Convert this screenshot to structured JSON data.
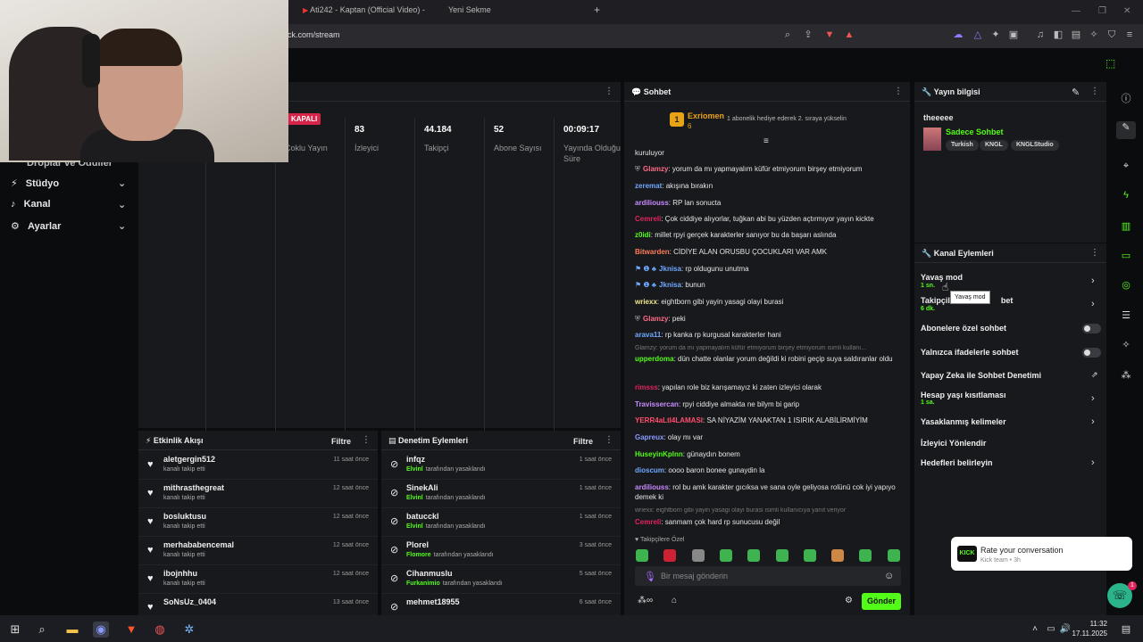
{
  "browser": {
    "tabs": [
      {
        "label": "Ati242 - Kaptan (Official Video) -"
      },
      {
        "label": "Yeni Sekme"
      }
    ],
    "new_tab_label": "+",
    "url": "ck.com/stream"
  },
  "sidebar": {
    "partial_item": "Droplar ve Ödüller",
    "items": [
      {
        "label": "Stüdyo"
      },
      {
        "label": "Kanal"
      },
      {
        "label": "Ayarlar"
      }
    ]
  },
  "stats": {
    "status_badge": "KAPALI",
    "items": [
      {
        "value": "",
        "label": "Çoklu Yayın"
      },
      {
        "value": "83",
        "label": "İzleyici"
      },
      {
        "value": "44.184",
        "label": "Takipçi"
      },
      {
        "value": "52",
        "label": "Abone Sayısı"
      },
      {
        "value": "00:09:17",
        "label": "Yayında Olduğu Süre"
      }
    ]
  },
  "activity": {
    "title": "Etkinlik Akışı",
    "filter_label": "Filtre",
    "events": [
      {
        "name": "aletgergin512",
        "sub": "kanalı takip etti",
        "time": "11 saat önce"
      },
      {
        "name": "mithrasthegreat",
        "sub": "kanalı takip etti",
        "time": "12 saat önce"
      },
      {
        "name": "bosluktusu",
        "sub": "kanalı takip etti",
        "time": "12 saat önce"
      },
      {
        "name": "merhababencemal",
        "sub": "kanalı takip etti",
        "time": "12 saat önce"
      },
      {
        "name": "ibojnhhu",
        "sub": "kanalı takip etti",
        "time": "12 saat önce"
      },
      {
        "name": "SoNsUz_0404",
        "sub": "",
        "time": "13 saat önce"
      }
    ]
  },
  "moderation": {
    "title": "Denetim Eylemleri",
    "filter_label": "Filtre",
    "actions": [
      {
        "name": "infqz",
        "mod": "Elvinl",
        "sub": "tarafından yasaklandı",
        "time": "1 saat önce"
      },
      {
        "name": "SinekAli",
        "mod": "Elvinl",
        "sub": "tarafından yasaklandı",
        "time": "1 saat önce"
      },
      {
        "name": "batucckl",
        "mod": "Elvinl",
        "sub": "tarafından yasaklandı",
        "time": "1 saat önce"
      },
      {
        "name": "Plorel",
        "mod": "Flomore",
        "sub": "tarafından yasaklandı",
        "time": "3 saat önce"
      },
      {
        "name": "Cihanmuslu",
        "mod": "Furkanimio",
        "sub": "tarafından yasaklandı",
        "time": "5 saat önce"
      },
      {
        "name": "mehmet18955",
        "mod": "",
        "sub": "",
        "time": "6 saat önce"
      }
    ]
  },
  "chat": {
    "title": "Sohbet",
    "pinned_user": "Exriomen",
    "pinned_count": "6",
    "pinned_text": "1 abonelik hediye ederek 2. sıraya yükselin",
    "messages": [
      {
        "user": "",
        "text": "kuruluyor",
        "color": "#e6e6e6"
      },
      {
        "user": "Glamzy",
        "text": ": yorum da mı yapmayalım küfür etmiyorum birşey etmiyorum",
        "color": "#ff6b8a"
      },
      {
        "user": "zeremat",
        "text": ": akışına bırakın",
        "color": "#6fa8ff"
      },
      {
        "user": "ardiliouss",
        "text": ": RP lan sonucta",
        "color": "#c88bff"
      },
      {
        "user": "Cemreli",
        "text": ": Çok ciddiye alıyorlar, tuğkan abi bu yüzden açtırmıyor yayın kickte",
        "color": "#e0245e"
      },
      {
        "user": "z0idi",
        "text": ": millet rpyi gerçek karakterler sanıyor bu da başarı aslında",
        "color": "#53fc18"
      },
      {
        "user": "Bitwarden",
        "text": ": CİDİYE ALAN ORUSBU ÇOCUKLARI VAR AMK",
        "color": "#ff7b5c"
      },
      {
        "user": "Jknisa",
        "text": ": rp oldugunu unutma",
        "color": "#6fa8ff"
      },
      {
        "user": "Jknisa",
        "text": ": bunun",
        "color": "#6fa8ff"
      },
      {
        "user": "wriexx",
        "text": ": eightborn gibi yayin yasagi olayi burasi",
        "color": "#f0e68c"
      },
      {
        "user": "Glamzy",
        "text": ": peki",
        "color": "#ff6b8a"
      },
      {
        "user": "arava11",
        "text": ": rp kanka rp kurgusal karakterler hani",
        "color": "#6fa8ff"
      },
      {
        "user": "upperdoma",
        "text": ": dün chatte olanlar yorum değildi ki robini geçip suya saldıranlar oldu",
        "color": "#53fc18",
        "reply": "Glamzy: yorum da mı yapmayalım küfür etmiyorum birşey etmiyorum isimli kullanı..."
      },
      {
        "user": "rimsss",
        "text": ": yapılan role biz karışamayız ki zaten izleyici olarak",
        "color": "#e0245e"
      },
      {
        "user": "Travissercan",
        "text": ": rpyi ciddiye almakta ne bilym bi garip",
        "color": "#c88bff"
      },
      {
        "user": "YERR4aLtI4LAMASI",
        "text": ": SA NİYAZİM YANAKTAN 1 ISIRIK ALABİLİRMİYİM",
        "color": "#ff4d6d"
      },
      {
        "user": "Gapreux",
        "text": ": olay mı var",
        "color": "#8b9bff"
      },
      {
        "user": "HuseyinKplnn",
        "text": ": günaydın bonem",
        "color": "#53fc18"
      },
      {
        "user": "dioscum",
        "text": ": oooo baron bonee gunaydin la",
        "color": "#6fa8ff"
      },
      {
        "user": "ardiliouss",
        "text": ": rol bu amk karakter gıcıksa ve sana oyle geliyosa rolünü cok iyi yapıyo demek ki",
        "color": "#c88bff"
      },
      {
        "user": "Cemreli",
        "text": ": sanmam çok hard rp sunucusu değil",
        "color": "#e0245e",
        "reply": "wriexx: eightborn gibi yayin yasagi olayi burasi isimli kullanıcıya yanıt veriyor"
      }
    ],
    "emote_label": "Takipçilere Özel",
    "input_placeholder": "Bir mesaj gönderin",
    "send_label": "Gönder"
  },
  "stream_info": {
    "title": "Yayın bilgisi",
    "stream_title": "theeeee",
    "category": "Sadece Sohbet",
    "tags": [
      "Turkish",
      "KNGL",
      "KNGLStudio"
    ]
  },
  "channel_actions": {
    "title": "Kanal Eylemleri",
    "rows": [
      {
        "label": "Yavaş mod",
        "sub": "1 sn.",
        "kind": "arrow"
      },
      {
        "label": "Takipçilere özel sohbet",
        "sub": "6 dk.",
        "kind": "arrow"
      },
      {
        "label": "Abonelere özel sohbet",
        "sub": "",
        "kind": "toggle"
      },
      {
        "label": "Yalnızca ifadelerle sohbet",
        "sub": "",
        "kind": "toggle"
      },
      {
        "label": "Yapay Zeka ile Sohbet Denetimi",
        "sub": "",
        "kind": "external"
      },
      {
        "label": "Hesap yaşı kısıtlaması",
        "sub": "1 sa.",
        "kind": "arrow"
      },
      {
        "label": "Yasaklanmış kelimeler",
        "sub": "",
        "kind": "arrow"
      },
      {
        "label": "İzleyici Yönlendir",
        "sub": "",
        "kind": "none"
      },
      {
        "label": "Hedefleri belirleyin",
        "sub": "",
        "kind": "arrow"
      }
    ],
    "tooltip": "Yavaş mod",
    "partial_label": "Takipçil",
    "partial_label_tail": "bet"
  },
  "toast": {
    "title": "Rate your conversation",
    "sub": "Kick team • 3h",
    "badge": "1"
  },
  "taskbar": {
    "time": "11:32",
    "date": "17.11.2025"
  },
  "colors": {
    "kick_green": "#53fc18",
    "status_red": "#d6244a",
    "panel_bg": "#18191c"
  }
}
